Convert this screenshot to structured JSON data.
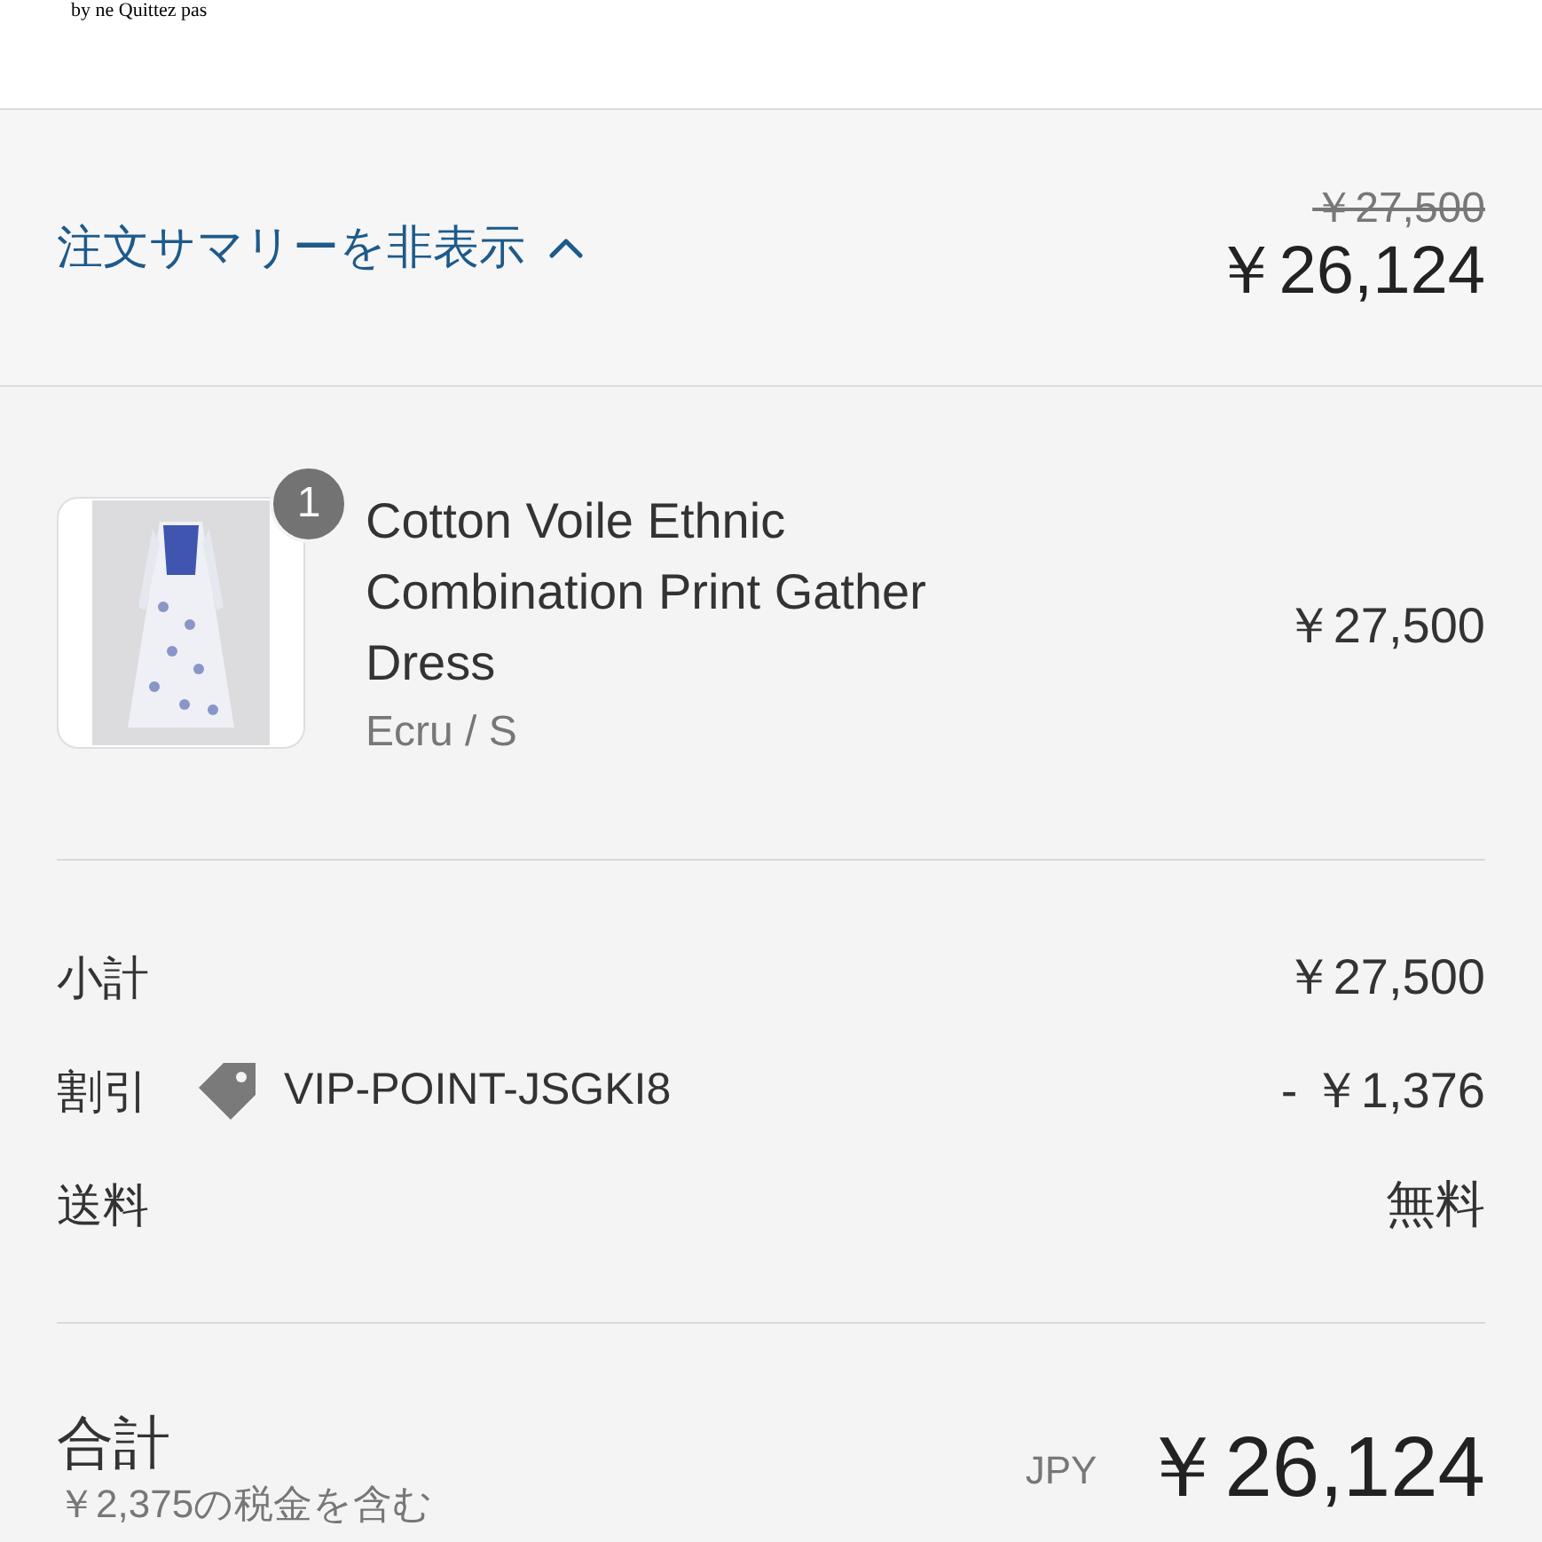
{
  "header": {
    "logo_text": "by ne Quittez pas"
  },
  "summary_toggle": {
    "label": "注文サマリーを非表示",
    "expanded": true,
    "original_price": "￥27,500",
    "price": "￥26,124"
  },
  "items": [
    {
      "quantity": "1",
      "name": "Cotton Voile Ethnic Combination Print Gather Dress",
      "variant": "Ecru / S",
      "price": "￥27,500"
    }
  ],
  "costs": [
    {
      "kind": "plain",
      "label": "小計",
      "value": "￥27,500"
    },
    {
      "kind": "discount",
      "label": "割引",
      "code": "VIP-POINT-JSGKI8",
      "value": "- ￥1,376"
    },
    {
      "kind": "plain",
      "label": "送料",
      "value": "無料"
    }
  ],
  "total": {
    "label": "合計",
    "tax_note": "￥2,375の税金を含む",
    "currency": "JPY",
    "value": "￥26,124"
  }
}
